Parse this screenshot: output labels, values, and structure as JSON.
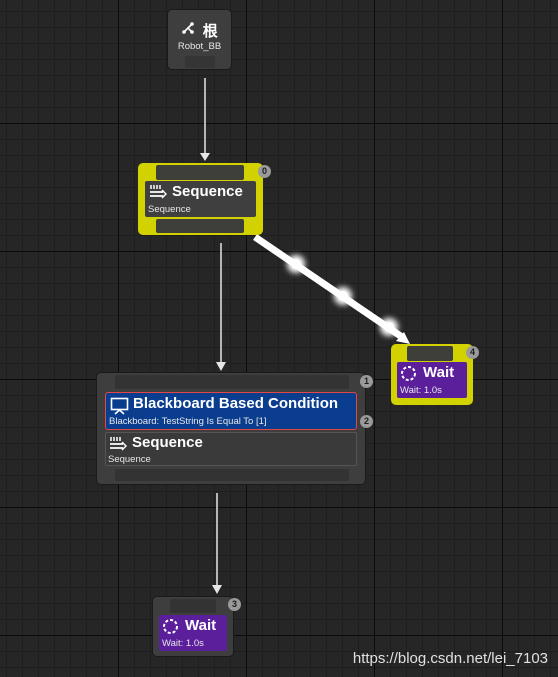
{
  "root": {
    "title": "根",
    "subtitle": "Robot_BB"
  },
  "sequence_top": {
    "index": "0",
    "title": "Sequence",
    "subtitle": "Sequence"
  },
  "wait_right": {
    "index": "4",
    "title": "Wait",
    "subtitle": "Wait: 1.0s"
  },
  "composite": {
    "index_top": "1",
    "decorator": {
      "index": "2",
      "title": "Blackboard Based Condition",
      "subtitle": "Blackboard: TestString Is Equal To [1]"
    },
    "sequence": {
      "title": "Sequence",
      "subtitle": "Sequence"
    }
  },
  "wait_bottom": {
    "index": "3",
    "title": "Wait",
    "subtitle": "Wait: 1.0s"
  },
  "watermark": "https://blog.csdn.net/lei_7103",
  "colors": {
    "canvas": "#262626",
    "selected_outline": "#d4d400",
    "task": "#5b1f9c",
    "decorator": "#0b3d8f",
    "decorator_border": "#e24646"
  },
  "icons": {
    "root": "root-branch-icon",
    "sequence": "sequence-icon",
    "wait": "wait-icon",
    "decorator": "blackboard-icon"
  }
}
